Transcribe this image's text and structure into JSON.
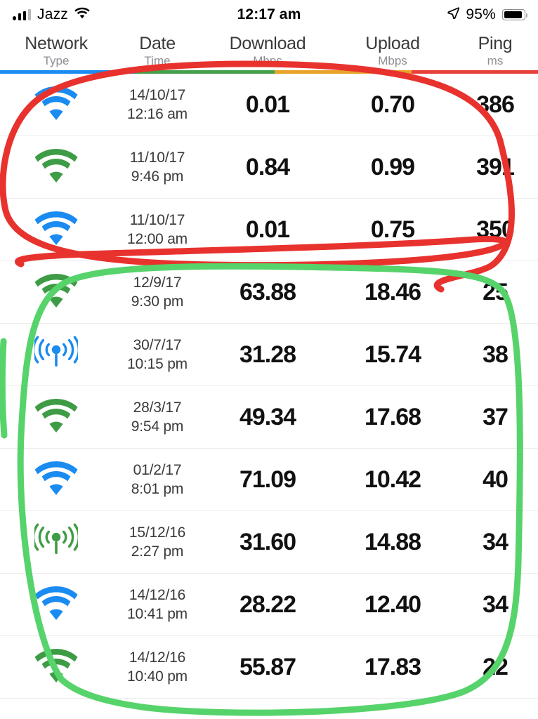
{
  "statusbar": {
    "carrier": "Jazz",
    "time": "12:17 am",
    "battery_percent": "95%",
    "signal_icon": "cellular-signal-bars-icon",
    "wifi_icon": "wifi-icon",
    "location_icon": "location-arrow-icon",
    "battery_icon": "battery-icon",
    "battery_level": 93
  },
  "header": {
    "columns": [
      {
        "main": "Network",
        "sub": "Type"
      },
      {
        "main": "Date",
        "sub": "Time"
      },
      {
        "main": "Download",
        "sub": "Mbps"
      },
      {
        "main": "Upload",
        "sub": "Mbps"
      },
      {
        "main": "Ping",
        "sub": "ms"
      }
    ]
  },
  "divider": {
    "segments": [
      {
        "color": "#1a8bf0",
        "width": "25%"
      },
      {
        "color": "#44a04c",
        "width": "26%"
      },
      {
        "color": "#e8a32a",
        "width": "25.5%"
      },
      {
        "color": "#e8403a",
        "width": "23.5%"
      }
    ]
  },
  "colors": {
    "wifi_blue": "#1a8bf0",
    "wifi_green": "#3f9c46",
    "annotation_red": "#e8322e",
    "annotation_green": "#56d36a",
    "text_dark": "#3a3a3c",
    "text_muted": "#8e8e93"
  },
  "rows": [
    {
      "icon": "wifi-icon",
      "icon_color": "#1a8bf0",
      "date": "14/10/17",
      "time": "12:16 am",
      "download": "0.01",
      "upload": "0.70",
      "ping": "386"
    },
    {
      "icon": "wifi-icon",
      "icon_color": "#3f9c46",
      "date": "11/10/17",
      "time": "9:46 pm",
      "download": "0.84",
      "upload": "0.99",
      "ping": "391"
    },
    {
      "icon": "wifi-icon",
      "icon_color": "#1a8bf0",
      "date": "11/10/17",
      "time": "12:00 am",
      "download": "0.01",
      "upload": "0.75",
      "ping": "350"
    },
    {
      "icon": "wifi-icon",
      "icon_color": "#3f9c46",
      "date": "12/9/17",
      "time": "9:30 pm",
      "download": "63.88",
      "upload": "18.46",
      "ping": "25"
    },
    {
      "icon": "cellular-icon",
      "icon_color": "#1a8bf0",
      "date": "30/7/17",
      "time": "10:15 pm",
      "download": "31.28",
      "upload": "15.74",
      "ping": "38"
    },
    {
      "icon": "wifi-icon",
      "icon_color": "#3f9c46",
      "date": "28/3/17",
      "time": "9:54 pm",
      "download": "49.34",
      "upload": "17.68",
      "ping": "37"
    },
    {
      "icon": "wifi-icon",
      "icon_color": "#1a8bf0",
      "date": "01/2/17",
      "time": "8:01 pm",
      "download": "71.09",
      "upload": "10.42",
      "ping": "40"
    },
    {
      "icon": "cellular-icon",
      "icon_color": "#3f9c46",
      "date": "15/12/16",
      "time": "2:27 pm",
      "download": "31.60",
      "upload": "14.88",
      "ping": "34"
    },
    {
      "icon": "wifi-icon",
      "icon_color": "#1a8bf0",
      "date": "14/12/16",
      "time": "10:41 pm",
      "download": "28.22",
      "upload": "12.40",
      "ping": "34"
    },
    {
      "icon": "wifi-icon",
      "icon_color": "#3f9c46",
      "date": "14/12/16",
      "time": "10:40 pm",
      "download": "55.87",
      "upload": "17.83",
      "ping": "22"
    }
  ],
  "annotations": [
    {
      "name": "red-circle-annotation",
      "color": "#e8322e",
      "encloses": "rows 1-3 (slow results)"
    },
    {
      "name": "green-circle-annotation",
      "color": "#56d36a",
      "encloses": "rows 4-10 (fast results)"
    }
  ]
}
